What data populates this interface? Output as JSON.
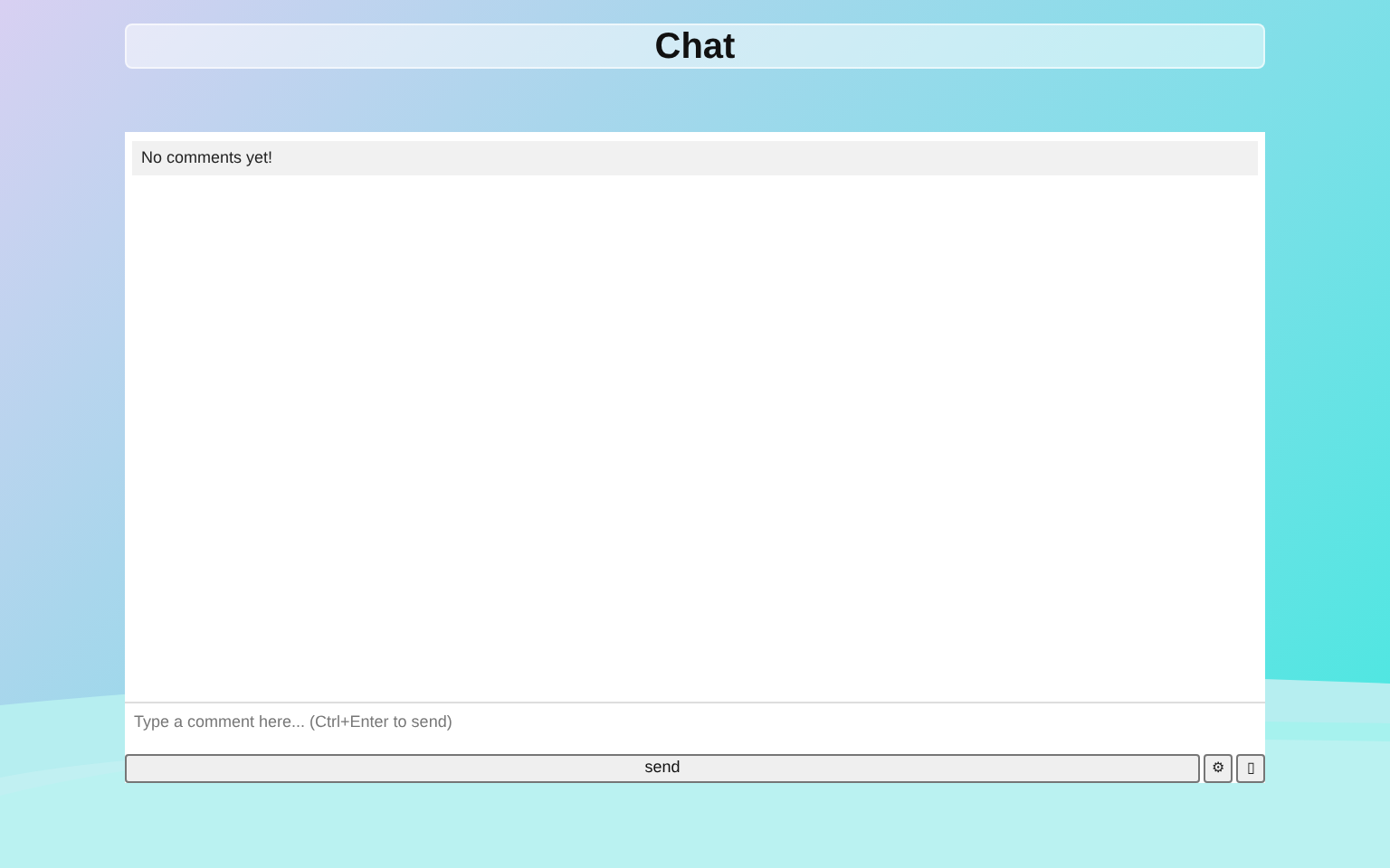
{
  "header": {
    "title": "Chat"
  },
  "messages": {
    "empty_text": "No comments yet!"
  },
  "composer": {
    "placeholder": "Type a comment here... (Ctrl+Enter to send)"
  },
  "buttons": [
    {
      "label": "send",
      "kind": "wide"
    },
    {
      "label": "⚙",
      "kind": "small"
    },
    {
      "label": "▯",
      "kind": "small"
    }
  ]
}
